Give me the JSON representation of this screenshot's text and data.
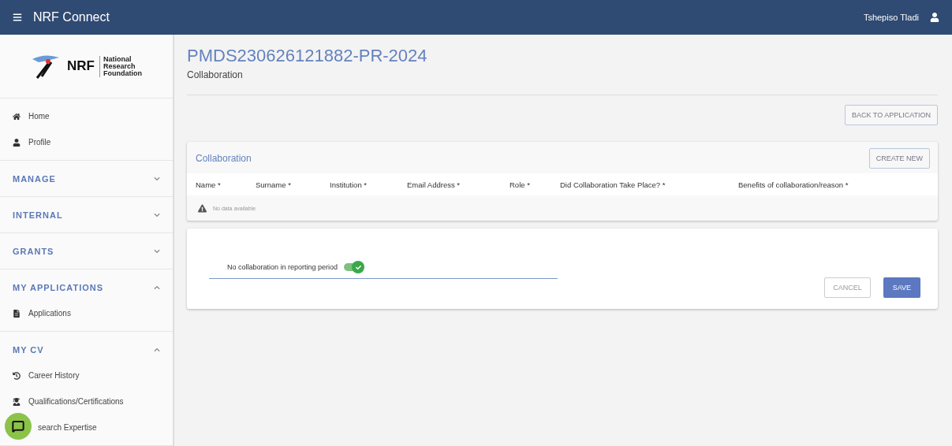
{
  "app_bar": {
    "title": "NRF Connect",
    "user": "Tshepiso Tladi"
  },
  "logo": {
    "mark": "NRF",
    "lines": [
      "National",
      "Research",
      "Foundation"
    ]
  },
  "sidebar": {
    "top_items": [
      {
        "label": "Home"
      },
      {
        "label": "Profile"
      }
    ],
    "sections": [
      {
        "title": "MANAGE",
        "expanded": false
      },
      {
        "title": "INTERNAL",
        "expanded": false
      },
      {
        "title": "GRANTS",
        "expanded": false
      },
      {
        "title": "MY APPLICATIONS",
        "expanded": true,
        "items": [
          {
            "label": "Applications"
          }
        ]
      },
      {
        "title": "MY CV",
        "expanded": true,
        "items": [
          {
            "label": "Career History"
          },
          {
            "label": "Qualifications/Certifications"
          },
          {
            "label": "search Expertise"
          }
        ]
      }
    ]
  },
  "page": {
    "title": "PMDS230626121882-PR-2024",
    "subtitle": "Collaboration",
    "back_button": "BACK TO APPLICATION"
  },
  "table": {
    "title": "Collaboration",
    "create_button": "CREATE NEW",
    "columns": [
      "Name *",
      "Surname *",
      "Institution *",
      "Email Address *",
      "Role *",
      "Did Collaboration Take Place? *",
      "Benefits of collaboration/reason *"
    ],
    "empty_message": "No data available"
  },
  "form": {
    "toggle": {
      "label": "No collaboration in reporting period",
      "on": true
    },
    "cancel": "CANCEL",
    "save": "SAVE"
  }
}
